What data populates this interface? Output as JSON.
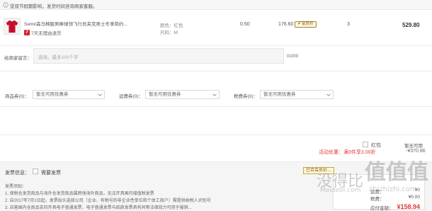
{
  "notice": {
    "text": "受双节假期影响，发货时间咨询商家客服。"
  },
  "product": {
    "name": "Semir森马棉服男棒球领飞行员夹克男士冬季简约...",
    "service_badge": "7",
    "service_text": "7天无理由退货",
    "color_label": "颜色：",
    "color_value": "红色",
    "size_label": "尺码：",
    "size_value": "M",
    "weight": "0.50",
    "price": "176.60",
    "member_badge": "会员价",
    "quantity": "3",
    "subtotal": "529.80"
  },
  "message": {
    "label": "给商家留言：",
    "placeholder": "选填，最多100个字",
    "count": "0/200"
  },
  "coupons": [
    {
      "label": "商品券(0)：",
      "placeholder": "暂无可用优惠券"
    },
    {
      "label": "运费券(0)：",
      "placeholder": "暂无可用优惠券"
    },
    {
      "label": "税费券(0)：",
      "placeholder": "暂无可用优惠券"
    }
  ],
  "promotion": {
    "label": "活动优惠：满3件享3.00折",
    "amount": "-¥370.86"
  },
  "redpacket": {
    "label": "红包",
    "status": "暂无可用"
  },
  "invoice": {
    "label": "发票信息：",
    "need_label": "需要发票",
    "notes_title": "发票须知：",
    "notes": [
      "1. 保税仓发货商品与海外仓发货商品属跨境海外商品，无法开具国内增值税发票",
      "2. 自2017年7月1日起，发票抬头选择公司（企业、有税号的非企业性单位和个体工商户）需提供纳税人识别号",
      "3. 自营国内仓商品支持开具电子普通发票，电子普通发票与纸质发票具有同等法律效力可用于报销..."
    ]
  },
  "summary": {
    "member_tag": "已合会员价…",
    "rows": [
      {
        "label": "运费：",
        "value": "¥0"
      },
      {
        "label": "税费：",
        "value": "¥0.00"
      }
    ],
    "total_label": "应付金额：",
    "total": "¥158.94"
  },
  "watermarks": {
    "left_cn": "没得比",
    "left_en": "Meidebi.com",
    "right_cn": "值值值",
    "right_en": "zhizhizhi.com"
  },
  "colors": {
    "accent_red": "#e4393c",
    "gold": "#a5812e",
    "bg_gray": "#f5f5f5"
  }
}
